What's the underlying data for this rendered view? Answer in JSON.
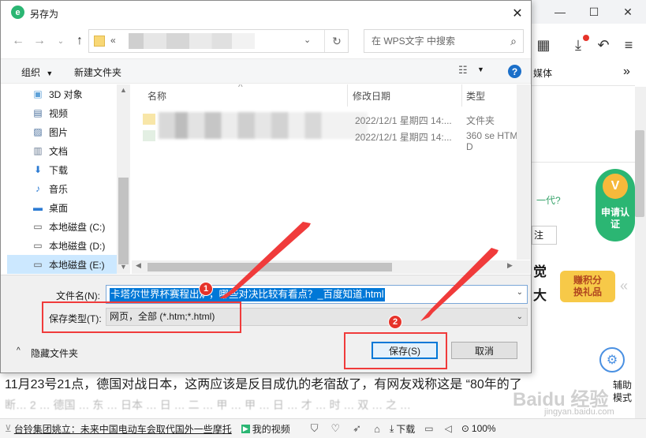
{
  "dialog": {
    "title": "另存为",
    "address_prefix": "«",
    "search_placeholder": "在 WPS文字 中搜索",
    "toolbar": {
      "organize": "组织",
      "new_folder": "新建文件夹"
    },
    "nav_items": [
      {
        "label": "3D 对象",
        "icon": "3d-objects-icon"
      },
      {
        "label": "视频",
        "icon": "video-icon"
      },
      {
        "label": "图片",
        "icon": "pictures-icon"
      },
      {
        "label": "文档",
        "icon": "documents-icon"
      },
      {
        "label": "下载",
        "icon": "download-icon"
      },
      {
        "label": "音乐",
        "icon": "music-icon"
      },
      {
        "label": "桌面",
        "icon": "desktop-icon"
      },
      {
        "label": "本地磁盘 (C:)",
        "icon": "drive-icon"
      },
      {
        "label": "本地磁盘 (D:)",
        "icon": "drive-icon"
      },
      {
        "label": "本地磁盘 (E:)",
        "icon": "drive-icon"
      }
    ],
    "columns": {
      "name": "名称",
      "date": "修改日期",
      "type": "类型"
    },
    "files": [
      {
        "date": "2022/12/1 星期四 14:...",
        "type": "文件夹"
      },
      {
        "date": "2022/12/1 星期四 14:...",
        "type": "360 se HTML D"
      }
    ],
    "filename_label": "文件名(N):",
    "filename_value": "卡塔尔世界杯赛程出炉，哪些对决比较有看点？_百度知道.html",
    "filetype_label": "保存类型(T):",
    "filetype_value": "网页，全部 (*.htm;*.html)",
    "hide_folders": "隐藏文件夹",
    "save": "保存(S)",
    "cancel": "取消",
    "annotations": [
      "1",
      "2"
    ],
    "colors": {
      "selection": "#0078d7",
      "annotation": "#e6332a"
    }
  },
  "browser": {
    "tab_fragment": "媒体",
    "side_text_1": "一代?",
    "side_text_2": "注",
    "side_text_3": "觉",
    "side_text_4": "大",
    "promo_1": "申请认证",
    "promo_2": "赚积分换礼品",
    "assist_label": "辅助模式",
    "article_line": "11月23号21点，德国对战日本，这两应该是反目成仇的老宿敌了，有网友戏称这是 “80年的了",
    "article_line2": "断… 2 … 德国 … 东 … 日本 … 日 … 二 … 甲 … 甲 … 日 … 才 … 时 … 双 … 之 …",
    "watermark": "Baidu 经验",
    "watermark_url": "jingyan.baidu.com",
    "status": {
      "news": "台铃集团姚立：未来中国电动车会取代国外一些摩托",
      "video": "我的视频",
      "download": "下载",
      "zoom": "100%"
    }
  }
}
